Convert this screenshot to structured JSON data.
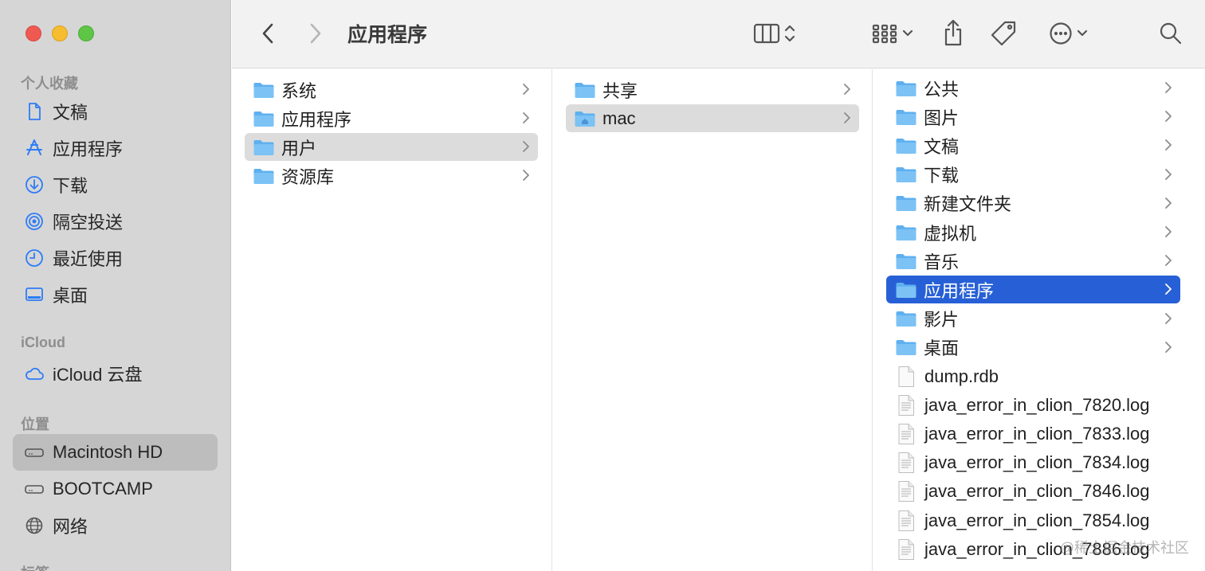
{
  "window": {
    "title": "应用程序"
  },
  "sidebar": {
    "favorites_title": "个人收藏",
    "favorites": [
      {
        "label": "文稿",
        "icon": "document-icon"
      },
      {
        "label": "应用程序",
        "icon": "applications-icon"
      },
      {
        "label": "下载",
        "icon": "download-icon"
      },
      {
        "label": "隔空投送",
        "icon": "airdrop-icon"
      },
      {
        "label": "最近使用",
        "icon": "clock-icon"
      },
      {
        "label": "桌面",
        "icon": "desktop-icon"
      }
    ],
    "icloud_title": "iCloud",
    "icloud": [
      {
        "label": "iCloud 云盘",
        "icon": "cloud-icon"
      }
    ],
    "locations_title": "位置",
    "locations": [
      {
        "label": "Macintosh HD",
        "icon": "disk-icon",
        "active": true
      },
      {
        "label": "BOOTCAMP",
        "icon": "disk-icon"
      },
      {
        "label": "网络",
        "icon": "globe-icon"
      }
    ],
    "tags_title": "标签"
  },
  "columns": {
    "col1": [
      {
        "label": "系统",
        "type": "folder"
      },
      {
        "label": "应用程序",
        "type": "folder"
      },
      {
        "label": "用户",
        "type": "folder",
        "selected": true
      },
      {
        "label": "资源库",
        "type": "folder"
      }
    ],
    "col2": [
      {
        "label": "共享",
        "type": "folder"
      },
      {
        "label": "mac",
        "type": "folder",
        "selected": true
      }
    ],
    "col3": [
      {
        "label": "公共",
        "type": "folder"
      },
      {
        "label": "图片",
        "type": "folder"
      },
      {
        "label": "文稿",
        "type": "folder"
      },
      {
        "label": "下载",
        "type": "folder"
      },
      {
        "label": "新建文件夹",
        "type": "folder"
      },
      {
        "label": "虚拟机",
        "type": "folder"
      },
      {
        "label": "音乐",
        "type": "folder"
      },
      {
        "label": "应用程序",
        "type": "folder",
        "selected": true
      },
      {
        "label": "影片",
        "type": "folder"
      },
      {
        "label": "桌面",
        "type": "folder"
      },
      {
        "label": "dump.rdb",
        "type": "file"
      },
      {
        "label": "java_error_in_clion_7820.log",
        "type": "file"
      },
      {
        "label": "java_error_in_clion_7833.log",
        "type": "file"
      },
      {
        "label": "java_error_in_clion_7834.log",
        "type": "file"
      },
      {
        "label": "java_error_in_clion_7846.log",
        "type": "file"
      },
      {
        "label": "java_error_in_clion_7854.log",
        "type": "file"
      },
      {
        "label": "java_error_in_clion_7886.log",
        "type": "file"
      }
    ]
  },
  "watermark": "@稀土掘金技术社区",
  "colors": {
    "selection_blue": "#2760d6",
    "folder_blue": "#5fb0ef",
    "sidebar_bg": "#d6d6d6"
  }
}
